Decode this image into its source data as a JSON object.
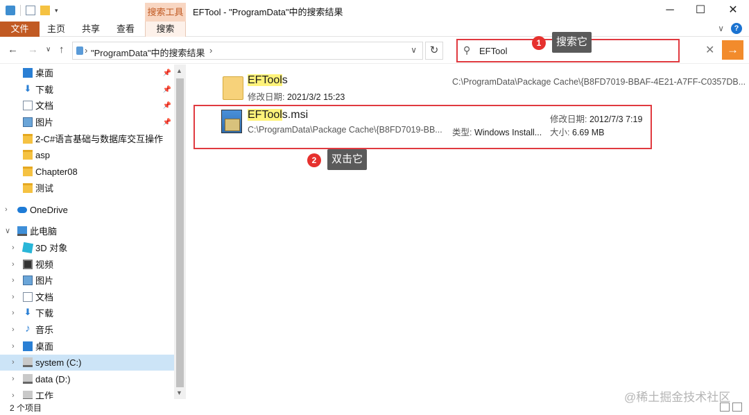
{
  "window": {
    "title": "EFTool - \"ProgramData\"中的搜索结果",
    "context_tab_group": "搜索工具",
    "minimize": "─",
    "maximize": "☐",
    "close": "✕"
  },
  "ribbon": {
    "tabs": [
      "文件",
      "主页",
      "共享",
      "查看",
      "搜索"
    ],
    "collapse": "∨",
    "help": "?"
  },
  "address": {
    "path": "\"ProgramData\"中的搜索结果",
    "separator": "›",
    "dropdown": "∨",
    "refresh": "↻"
  },
  "search": {
    "value": "EFTool",
    "clear": "✕",
    "go": "→"
  },
  "callouts": [
    {
      "num": "1",
      "text": "搜索它"
    },
    {
      "num": "2",
      "text": "双击它"
    }
  ],
  "sidebar": {
    "quick_access": [
      {
        "label": "桌面",
        "icon": "desktop-icon",
        "pinned": true
      },
      {
        "label": "下载",
        "icon": "download-icon",
        "pinned": true
      },
      {
        "label": "文档",
        "icon": "document-icon",
        "pinned": true
      },
      {
        "label": "图片",
        "icon": "picture-icon",
        "pinned": true
      },
      {
        "label": "2-C#语言基础与数据库交互操作",
        "icon": "folder-icon",
        "pinned": false
      },
      {
        "label": "asp",
        "icon": "folder-icon",
        "pinned": false
      },
      {
        "label": "Chapter08",
        "icon": "folder-icon",
        "pinned": false
      },
      {
        "label": "测试",
        "icon": "folder-icon",
        "pinned": false
      }
    ],
    "onedrive": "OneDrive",
    "this_pc": "此电脑",
    "pc_items": [
      {
        "label": "3D 对象",
        "icon": "3d-objects-icon"
      },
      {
        "label": "视频",
        "icon": "video-icon"
      },
      {
        "label": "图片",
        "icon": "picture-icon"
      },
      {
        "label": "文档",
        "icon": "document-icon"
      },
      {
        "label": "下载",
        "icon": "download-icon"
      },
      {
        "label": "音乐",
        "icon": "music-icon"
      },
      {
        "label": "桌面",
        "icon": "desktop-icon"
      },
      {
        "label": "system (C:)",
        "icon": "drive-icon",
        "selected": true
      },
      {
        "label": "data (D:)",
        "icon": "drive-icon"
      }
    ],
    "partial_item": "工作"
  },
  "results": [
    {
      "name_highlight": "EFTool",
      "name_rest": "s",
      "modified_label": "修改日期:",
      "modified": "2021/3/2 15:23",
      "path": "C:\\ProgramData\\Package Cache\\{B8FD7019-BBAF-4E21-A7FF-C0357DB...",
      "icon": "folder-icon"
    },
    {
      "name_highlight": "EFTool",
      "name_rest": "s.msi",
      "path": "C:\\ProgramData\\Package Cache\\{B8FD7019-BB...",
      "type_label": "类型:",
      "type": "Windows Install...",
      "modified_label": "修改日期:",
      "modified": "2012/7/3 7:19",
      "size_label": "大小:",
      "size": "6.69 MB",
      "icon": "msi-installer-icon"
    }
  ],
  "status": {
    "item_count": "2 个项目"
  },
  "watermark": "@稀土掘金技术社区",
  "colors": {
    "file_tab": "#c15a23",
    "context_tab": "#f8d6c2",
    "callout_badge": "#e6312e",
    "highlight_box": "#e0393f",
    "search_go": "#f28b2c",
    "selection": "#cce4f7",
    "match_highlight": "#fff37a"
  }
}
